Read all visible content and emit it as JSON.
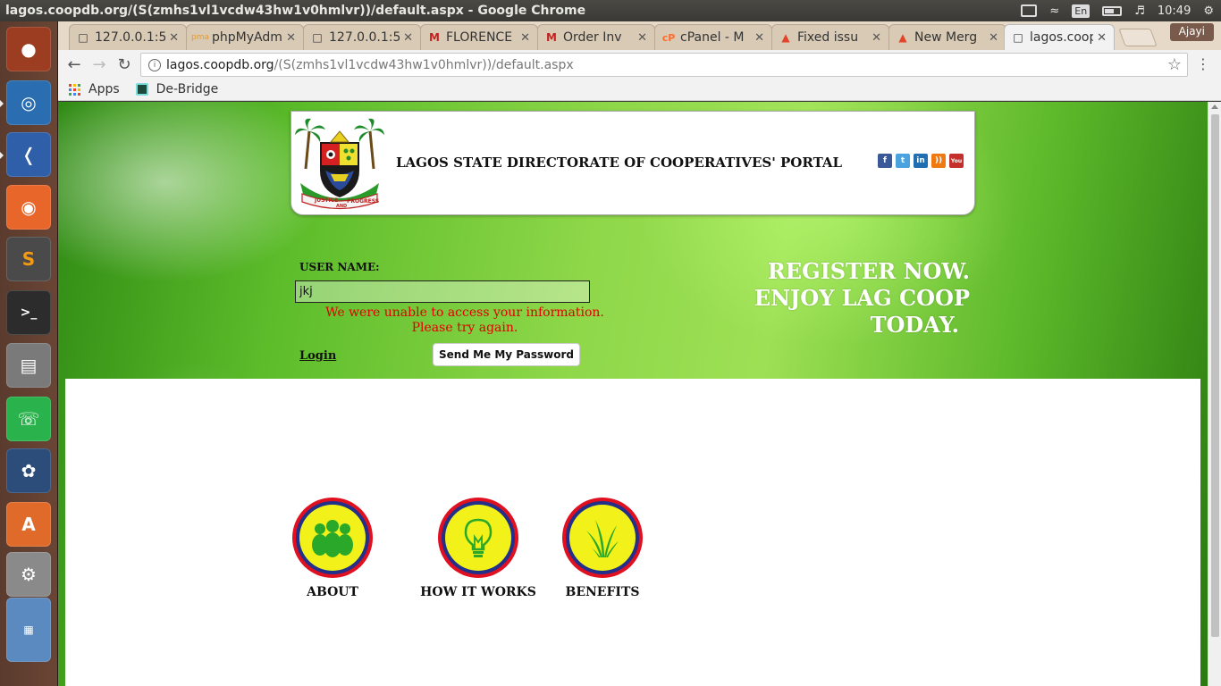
{
  "window": {
    "title": "lagos.coopdb.org/(S(zmhs1vl1vcdw43hw1v0hmlvr))/default.aspx - Google Chrome",
    "time": "10:49",
    "keyboard_lang": "En"
  },
  "tabs": [
    {
      "label": "127.0.0.1:5",
      "icon": "page-icon",
      "active": false
    },
    {
      "label": "phpMyAdmin",
      "icon": "pma-icon",
      "active": false
    },
    {
      "label": "127.0.0.1:5",
      "icon": "page-icon",
      "active": false
    },
    {
      "label": "FLORENCE",
      "icon": "gmail-icon",
      "active": false
    },
    {
      "label": "Order Inv",
      "icon": "gmail-icon",
      "active": false
    },
    {
      "label": "cPanel - M",
      "icon": "cpanel-icon",
      "active": false
    },
    {
      "label": "Fixed issu",
      "icon": "gitlab-icon",
      "active": false
    },
    {
      "label": "New Merg",
      "icon": "gitlab-icon",
      "active": false
    },
    {
      "label": "lagos.coop",
      "icon": "page-icon",
      "active": true
    }
  ],
  "profile": "Ajayi",
  "address": {
    "host": "lagos.coopdb.org",
    "path": "/(S(zmhs1vl1vcdw43hw1v0hmlvr))/default.aspx"
  },
  "bookmarks": {
    "apps": "Apps",
    "debridge": "De-Bridge"
  },
  "page": {
    "portal_title": "LAGOS STATE DIRECTORATE OF COOPERATIVES' PORTAL",
    "crest_motto_left": "JUSTICE",
    "crest_motto_mid": "AND",
    "crest_motto_right": "PROGRESS",
    "social": [
      {
        "name": "facebook-icon",
        "glyph": "f",
        "color": "#3b5998"
      },
      {
        "name": "twitter-icon",
        "glyph": "t",
        "color": "#4aa3df"
      },
      {
        "name": "linkedin-icon",
        "glyph": "in",
        "color": "#1f6fb2"
      },
      {
        "name": "rss-icon",
        "glyph": "))",
        "color": "#f07a12"
      },
      {
        "name": "youtube-icon",
        "glyph": "You",
        "color": "#c4302b"
      }
    ],
    "login": {
      "user_label": "USER NAME:",
      "user_value": "jkj",
      "error": "We were unable to access your information. Please try again.",
      "login_link": "Login",
      "send_button": "Send Me My Password"
    },
    "register": {
      "line1": "REGISTER NOW.",
      "line2": "ENJOY LAG COOP",
      "line3": "TODAY."
    },
    "features": [
      {
        "label": "ABOUT",
        "icon": "people-icon"
      },
      {
        "label": "HOW IT WORKS",
        "icon": "lightbulb-icon"
      },
      {
        "label": "BENEFITS",
        "icon": "grass-icon"
      }
    ]
  },
  "colors": {
    "error": "#e00000",
    "circle_outer": "#e01020",
    "circle_ring": "#22308a",
    "circle_fill": "#f2f21a"
  }
}
